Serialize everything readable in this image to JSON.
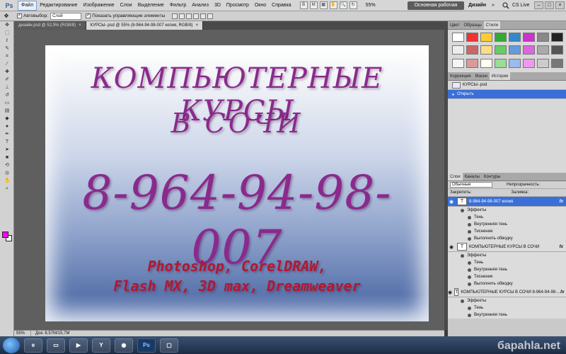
{
  "app": {
    "logo": "Ps"
  },
  "menu": [
    "Файл",
    "Редактирование",
    "Изображение",
    "Слои",
    "Выделение",
    "Фильтр",
    "Анализ",
    "3D",
    "Просмотр",
    "Окно",
    "Справка"
  ],
  "menubar": {
    "zoom": "55%",
    "workspace": "Основная рабочая среда",
    "design": "Дизайн",
    "chevron": "»",
    "cslive": "CS Live"
  },
  "options": {
    "autoselect_label": "Автовыбор:",
    "autoselect_value": "Слой",
    "show_transform": "Показать управляющие элементы"
  },
  "tabs": [
    {
      "label": "дизайн.psd @ 52,5% (RGB/8)"
    },
    {
      "label": "КУРСЫ-.psd @ 55% (8-964-94-98-007 копия, RGB/8)"
    }
  ],
  "artboard": {
    "title": "КОМПЬЮТЕРНЫЕ КУРСЫ",
    "city": "В СОЧИ",
    "phone": "8-964-94-98-007",
    "software_line1": "Photoshop, CorelDRAW,",
    "software_line2": "Flash MX, 3D max, Dreamweaver"
  },
  "status": {
    "zoom": "55%",
    "doc": "Док: 8,57M/15,7M"
  },
  "panels": {
    "top_tabs": [
      "Цвет",
      "Образцы",
      "Стили"
    ],
    "mid_tabs": [
      "Коррекция",
      "Маски",
      "История"
    ],
    "history": {
      "source": "КУРСЫ-.psd",
      "step": "Открыть"
    },
    "layer_tabs": [
      "Слои",
      "Каналы",
      "Контуры"
    ],
    "blend_mode": "Обычные",
    "opacity_label": "Непрозрачность:",
    "lock_label": "Закрепить:",
    "fill_label": "Заливка:",
    "layers": [
      {
        "name": "8-964-94-98-007 копия",
        "fx": "fx",
        "selected": true,
        "effects_label": "Эффекты",
        "effects": [
          "Тень",
          "Внутренняя тень",
          "Тиснение",
          "Выполнить обводку"
        ]
      },
      {
        "name": "КОМПЬЮТЕРНЫЕ КУРСЫ В СОЧИ",
        "fx": "fx",
        "selected": false,
        "effects_label": "Эффекты",
        "effects": [
          "Тень",
          "Внутренняя тень",
          "Тиснение",
          "Выполнить обводку"
        ]
      },
      {
        "name": "КОМПЬЮТЕРНЫЕ КУРСЫ В СОЧИ 8-964-94-98-...",
        "fx": "fx",
        "selected": false,
        "effects_label": "Эффекты",
        "effects": [
          "Тень",
          "Внутренняя тень"
        ]
      }
    ]
  },
  "taskbar": {
    "watermark": "бараhla.net"
  }
}
